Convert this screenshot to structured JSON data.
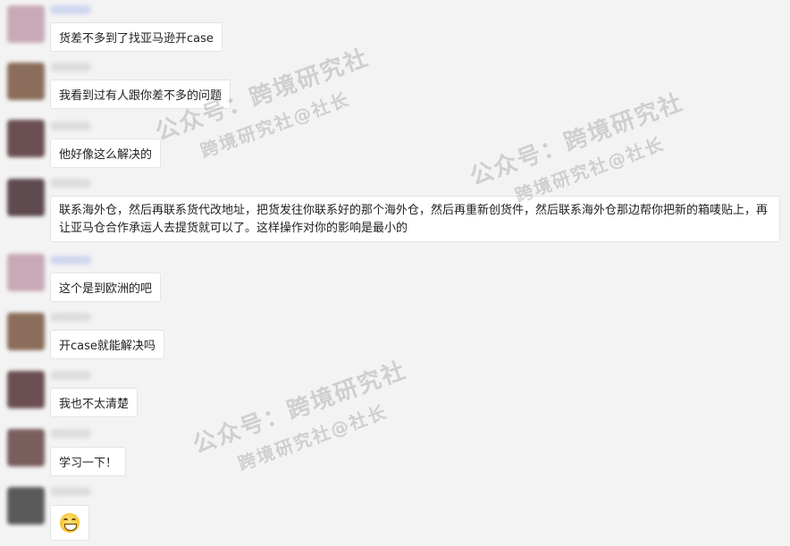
{
  "messages": [
    {
      "text": "货差不多到了找亚马逊开case",
      "avatar_color": "#c9a9b7"
    },
    {
      "text": "我看到过有人跟你差不多的问题",
      "avatar_color": "#8a6d5a"
    },
    {
      "text": "他好像这么解决的",
      "avatar_color": "#6b4f52"
    },
    {
      "text": "联系海外仓，然后再联系货代改地址，把货发往你联系好的那个海外仓，然后再重新创货件，然后联系海外仓那边帮你把新的箱唛贴上，再让亚马仓合作承运人去提货就可以了。这样操作对你的影响是最小的",
      "avatar_color": "#5e4a4f"
    },
    {
      "text": "这个是到欧洲的吧",
      "avatar_color": "#c9a9b7"
    },
    {
      "text": "开case就能解决吗",
      "avatar_color": "#8a6d5a"
    },
    {
      "text": "我也不太清楚",
      "avatar_color": "#6b4f52"
    },
    {
      "text": "学习一下！",
      "avatar_color": "#7a5e5e"
    },
    {
      "text": "",
      "emoji": "grinning-face",
      "avatar_color": "#5a5a5a"
    }
  ],
  "watermark": {
    "line1": "公众号：跨境研究社",
    "line2": "跨境研究社@社长"
  }
}
